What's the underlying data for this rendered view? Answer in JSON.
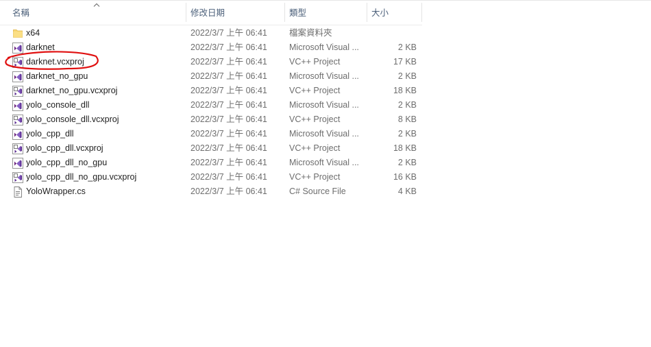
{
  "columns": {
    "name": "名稱",
    "date": "修改日期",
    "type": "類型",
    "size": "大小"
  },
  "sort": {
    "column": "name",
    "direction": "ascending"
  },
  "files": [
    {
      "name": "x64",
      "date": "2022/3/7 上午 06:41",
      "type": "檔案資料夾",
      "size": "",
      "icon": "folder-icon"
    },
    {
      "name": "darknet",
      "date": "2022/3/7 上午 06:41",
      "type": "Microsoft Visual ...",
      "size": "2 KB",
      "icon": "visual-studio-solution-icon"
    },
    {
      "name": "darknet.vcxproj",
      "date": "2022/3/7 上午 06:41",
      "type": "VC++ Project",
      "size": "17 KB",
      "icon": "vcxproj-icon",
      "highlighted": true
    },
    {
      "name": "darknet_no_gpu",
      "date": "2022/3/7 上午 06:41",
      "type": "Microsoft Visual ...",
      "size": "2 KB",
      "icon": "visual-studio-solution-icon"
    },
    {
      "name": "darknet_no_gpu.vcxproj",
      "date": "2022/3/7 上午 06:41",
      "type": "VC++ Project",
      "size": "18 KB",
      "icon": "vcxproj-icon"
    },
    {
      "name": "yolo_console_dll",
      "date": "2022/3/7 上午 06:41",
      "type": "Microsoft Visual ...",
      "size": "2 KB",
      "icon": "visual-studio-solution-icon"
    },
    {
      "name": "yolo_console_dll.vcxproj",
      "date": "2022/3/7 上午 06:41",
      "type": "VC++ Project",
      "size": "8 KB",
      "icon": "vcxproj-icon"
    },
    {
      "name": "yolo_cpp_dll",
      "date": "2022/3/7 上午 06:41",
      "type": "Microsoft Visual ...",
      "size": "2 KB",
      "icon": "visual-studio-solution-icon"
    },
    {
      "name": "yolo_cpp_dll.vcxproj",
      "date": "2022/3/7 上午 06:41",
      "type": "VC++ Project",
      "size": "18 KB",
      "icon": "vcxproj-icon"
    },
    {
      "name": "yolo_cpp_dll_no_gpu",
      "date": "2022/3/7 上午 06:41",
      "type": "Microsoft Visual ...",
      "size": "2 KB",
      "icon": "visual-studio-solution-icon"
    },
    {
      "name": "yolo_cpp_dll_no_gpu.vcxproj",
      "date": "2022/3/7 上午 06:41",
      "type": "VC++ Project",
      "size": "16 KB",
      "icon": "vcxproj-icon"
    },
    {
      "name": "YoloWrapper.cs",
      "date": "2022/3/7 上午 06:41",
      "type": "C# Source File",
      "size": "4 KB",
      "icon": "csharp-file-icon"
    }
  ],
  "annotation": {
    "color": "#e01010",
    "target": "darknet.vcxproj"
  }
}
